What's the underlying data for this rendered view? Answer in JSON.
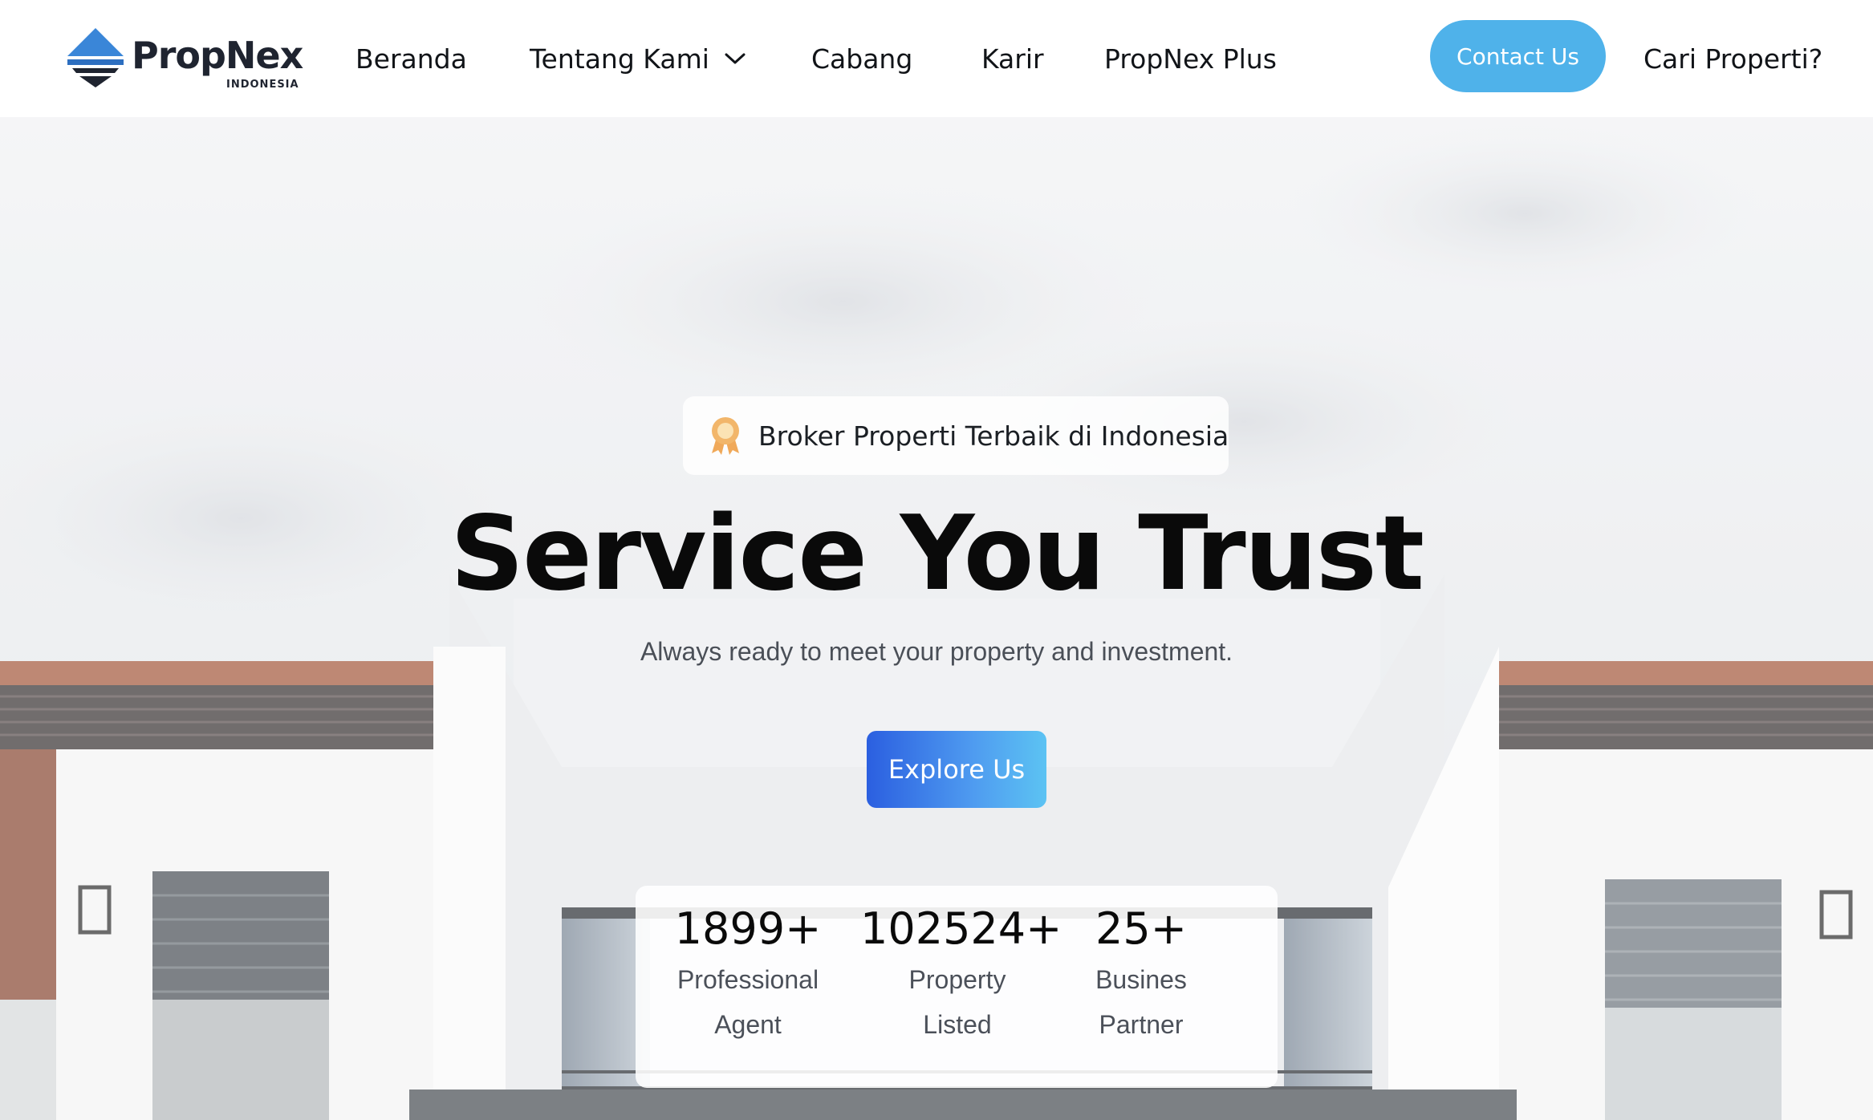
{
  "brand": {
    "name": "PropNex",
    "sub": "INDONESIA",
    "colors": {
      "logo_blue": "#3a86d8",
      "logo_dark": "#1f2430"
    }
  },
  "nav": {
    "items": [
      {
        "label": "Beranda"
      },
      {
        "label": "Tentang Kami",
        "icon": "chevron-down-icon"
      },
      {
        "label": "Cabang"
      },
      {
        "label": "Karir"
      },
      {
        "label": "PropNex Plus"
      }
    ],
    "contact_label": "Contact Us",
    "search_label": "Cari Properti?",
    "colors": {
      "contact_bg": "#4fb2ea"
    }
  },
  "hero": {
    "badge_icon": "award-ribbon-icon",
    "badge_text": "Broker Properti Terbaik di Indonesia",
    "headline": "Service You Trust",
    "subheadline": "Always ready to meet your property and investment.",
    "cta_label": "Explore Us",
    "colors": {
      "cta_start": "#2b5fe0",
      "cta_end": "#5cc3f3"
    }
  },
  "stats": [
    {
      "value": "1899+",
      "label_line1": "Professional",
      "label_line2": "Agent"
    },
    {
      "value": "102524+",
      "label_line1": "Property",
      "label_line2": "Listed"
    },
    {
      "value": "25+",
      "label_line1": "Busines",
      "label_line2": "Partner"
    }
  ]
}
